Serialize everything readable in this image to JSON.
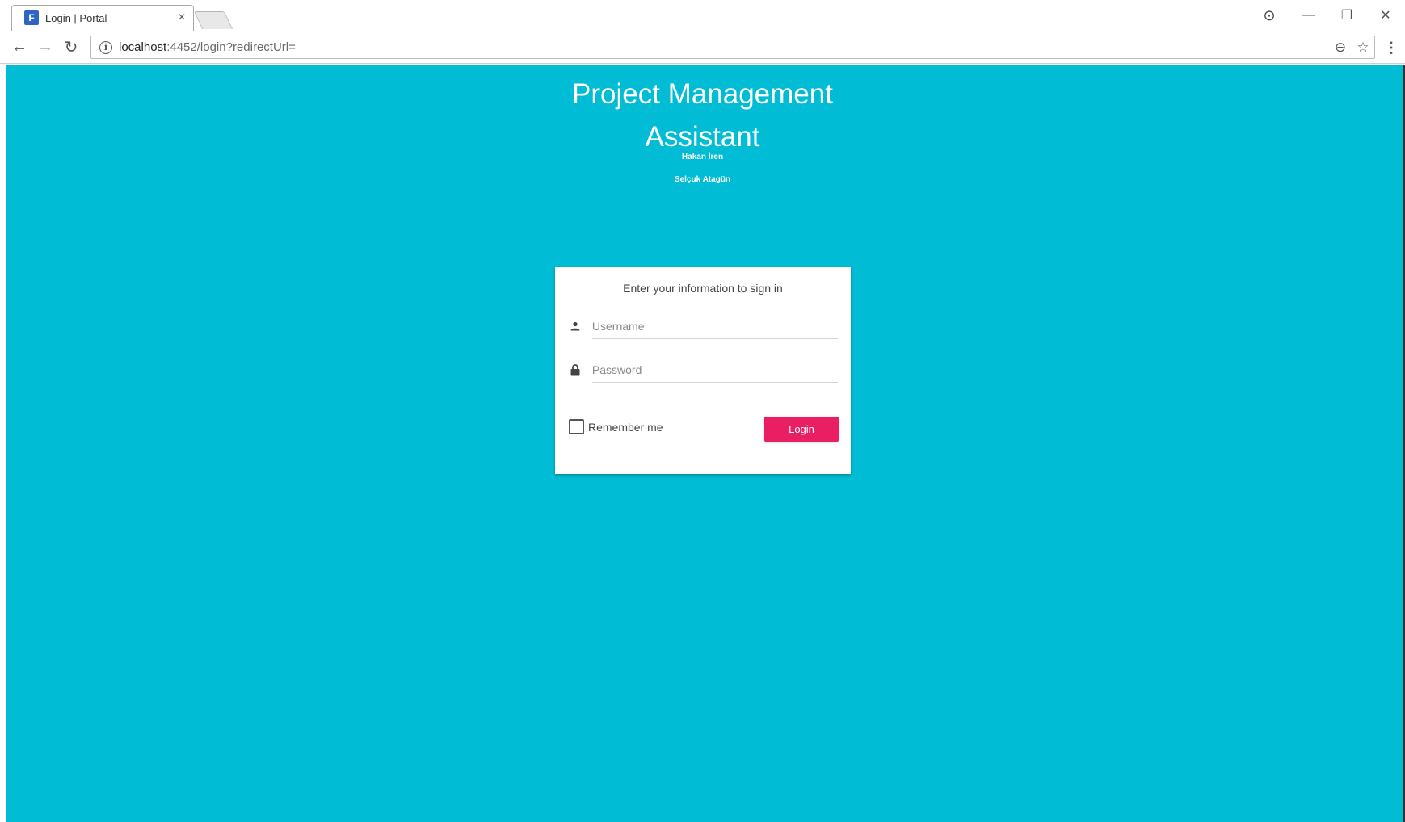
{
  "browser": {
    "tab_title": "Login | Portal",
    "tab_close": "×",
    "favicon_text": "F",
    "url_host": "localhost",
    "url_path": ":4452/login?redirectUrl=",
    "controls": {
      "profile": "⊙",
      "minimize": "—",
      "restore": "❐",
      "close": "✕"
    },
    "nav": {
      "back": "←",
      "forward": "→",
      "reload": "↻"
    },
    "omni_actions": {
      "zoom": "⊖",
      "bookmark": "☆"
    },
    "menu": "⋮"
  },
  "page": {
    "background_color": "#00bcd4",
    "title_line1": "Project Management",
    "title_line2": "Assistant",
    "author1": "Hakan İren",
    "author2": "Selçuk Atagün",
    "card": {
      "header": "Enter your information to sign in",
      "username_placeholder": "Username",
      "password_placeholder": "Password",
      "remember_label": "Remember me",
      "login_label": "Login"
    },
    "accent_color": "#e91e63"
  }
}
